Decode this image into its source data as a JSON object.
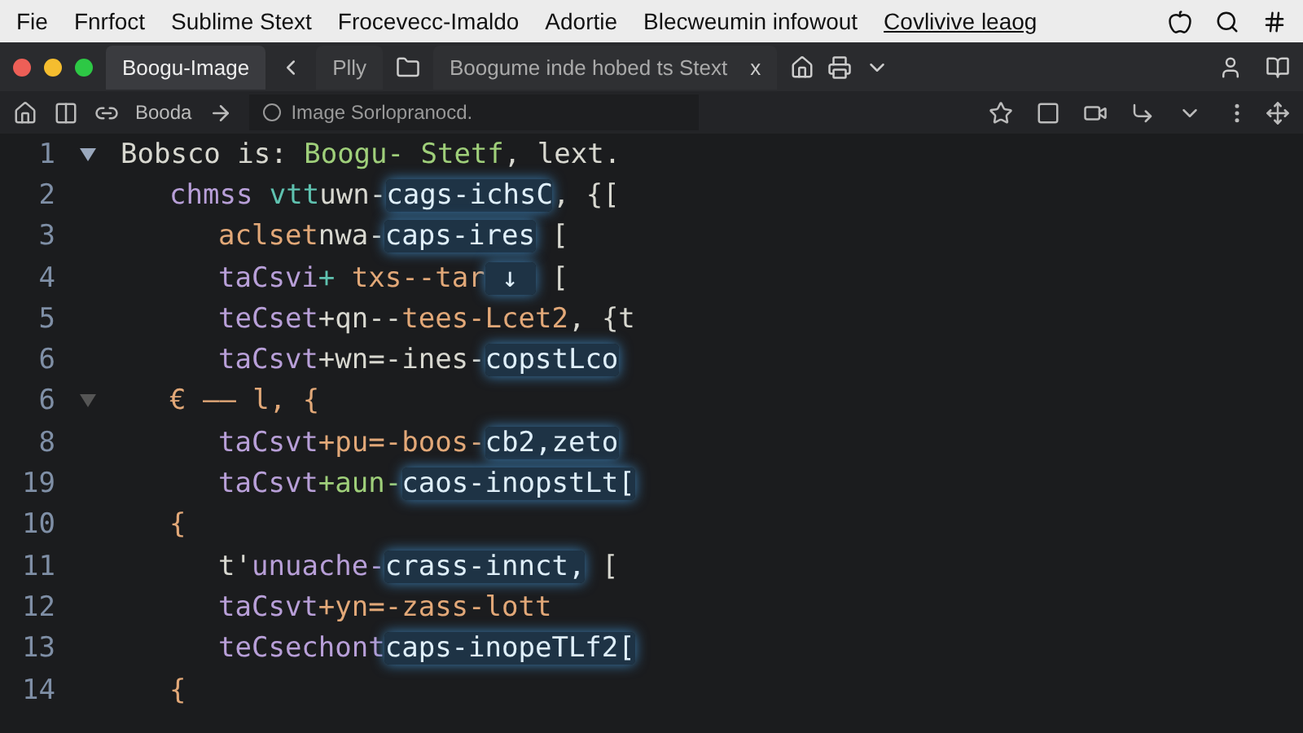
{
  "menu_bar": {
    "items": [
      {
        "label": "Fie",
        "underlined": false
      },
      {
        "label": "Fnrfoct",
        "underlined": false
      },
      {
        "label": "Sublime Stext",
        "underlined": false
      },
      {
        "label": "Frocevecc-Imaldo",
        "underlined": false
      },
      {
        "label": "Adortie",
        "underlined": false
      },
      {
        "label": "Blecweumin infowout",
        "underlined": false
      },
      {
        "label": "Covlivive leaog",
        "underlined": true
      }
    ]
  },
  "tabs": [
    {
      "label": "Boogu-Image",
      "selected": true
    },
    {
      "label": "Plly",
      "selected": false
    },
    {
      "label": "Boogume inde hobed ts Stext",
      "selected": false,
      "close": "x"
    }
  ],
  "toolbar": {
    "breadcrumb": "Booda",
    "address": "Image Sorlopranocd."
  },
  "editor": {
    "lines": [
      {
        "number": "1",
        "fold": true,
        "tokens": [
          {
            "text": "Bobsco is: ",
            "kind": "plain"
          },
          {
            "text": "Boogu- Stetf",
            "kind": "str"
          },
          {
            "text": ", lext.",
            "kind": "plain"
          }
        ],
        "children": [
          {
            "number": "2",
            "fold": false,
            "tokens": [
              {
                "text": "chmss",
                "kind": "kw"
              },
              {
                "text": " vtt",
                "kind": "type"
              },
              {
                "text": "uwn-",
                "kind": "plain"
              },
              {
                "text": "cags-ichsC",
                "kind": "glow"
              },
              {
                "text": ", {[",
                "kind": "plain"
              }
            ],
            "children": [
              {
                "number": "3",
                "fold": false,
                "tokens": [
                  {
                    "text": "aclset",
                    "kind": "fn"
                  },
                  {
                    "text": "nwa-",
                    "kind": "plain"
                  },
                  {
                    "text": "caps-ires",
                    "kind": "glow"
                  },
                  {
                    "text": " [",
                    "kind": "plain"
                  }
                ]
              },
              {
                "number": "4",
                "fold": false,
                "tokens": [
                  {
                    "text": "taCsvi",
                    "kind": "kw"
                  },
                  {
                    "text": "+ ",
                    "kind": "type"
                  },
                  {
                    "text": "txs--tar",
                    "kind": "fn"
                  },
                  {
                    "text": " ↓ ",
                    "kind": "glow"
                  },
                  {
                    "text": " [",
                    "kind": "plain"
                  }
                ]
              },
              {
                "number": "5",
                "fold": false,
                "tokens": [
                  {
                    "text": "teCset",
                    "kind": "kw"
                  },
                  {
                    "text": "+qn--",
                    "kind": "plain"
                  },
                  {
                    "text": "tees-Lcet2",
                    "kind": "fn"
                  },
                  {
                    "text": ", {t",
                    "kind": "plain"
                  }
                ]
              },
              {
                "number": "6",
                "fold": false,
                "tokens": [
                  {
                    "text": "taCsvt",
                    "kind": "kw"
                  },
                  {
                    "text": "+wn=-ines-",
                    "kind": "plain"
                  },
                  {
                    "text": "copstLco",
                    "kind": "glow"
                  }
                ]
              }
            ]
          },
          {
            "number": "6",
            "fold": true,
            "tokens": [
              {
                "text": "€ —— l, {",
                "kind": "fn"
              }
            ],
            "children": [
              {
                "number": "8",
                "fold": false,
                "tokens": [
                  {
                    "text": "taCsvt",
                    "kind": "kw"
                  },
                  {
                    "text": "+pu=-boos-",
                    "kind": "fn"
                  },
                  {
                    "text": "cb2,zeto",
                    "kind": "glow"
                  }
                ]
              },
              {
                "number": "19",
                "fold": false,
                "tokens": [
                  {
                    "text": "taCsvt",
                    "kind": "kw"
                  },
                  {
                    "text": "+aun-",
                    "kind": "str"
                  },
                  {
                    "text": "caos-inopstLt[",
                    "kind": "glow"
                  }
                ]
              }
            ]
          },
          {
            "number": "10",
            "fold": false,
            "tokens": [
              {
                "text": "{",
                "kind": "fn"
              }
            ],
            "children": [
              {
                "number": "11",
                "fold": false,
                "tokens": [
                  {
                    "text": "t'",
                    "kind": "plain"
                  },
                  {
                    "text": "unuache-",
                    "kind": "kw"
                  },
                  {
                    "text": "crass-innct,",
                    "kind": "glow"
                  },
                  {
                    "text": " [",
                    "kind": "plain"
                  }
                ]
              },
              {
                "number": "12",
                "fold": false,
                "tokens": [
                  {
                    "text": "taCsvt",
                    "kind": "kw"
                  },
                  {
                    "text": "+yn=-zass-lott",
                    "kind": "fn"
                  }
                ]
              },
              {
                "number": "13",
                "fold": false,
                "tokens": [
                  {
                    "text": "teCsechont",
                    "kind": "kw"
                  },
                  {
                    "text": "caps-inopeTLf2[",
                    "kind": "glow"
                  }
                ]
              }
            ]
          },
          {
            "number": "14",
            "fold": false,
            "tokens": [
              {
                "text": "{",
                "kind": "fn"
              }
            ]
          }
        ]
      }
    ]
  }
}
